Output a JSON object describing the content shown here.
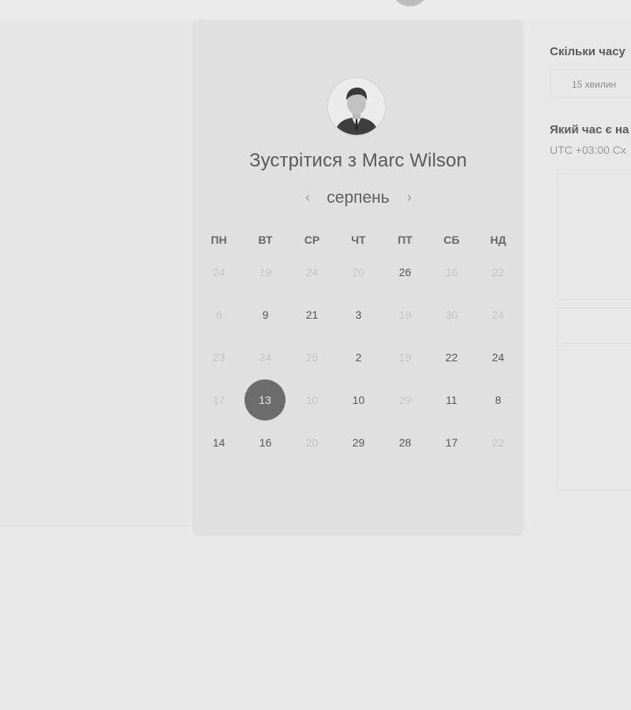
{
  "host": {
    "title": "Зустрітися з Marc Wilson",
    "avatar_icon": "person-avatar"
  },
  "calendar": {
    "month": "серпень",
    "prev_icon": "chevron-left-icon",
    "next_icon": "chevron-right-icon",
    "prev_glyph": "‹",
    "next_glyph": "›",
    "weekdays": [
      "ПН",
      "ВТ",
      "СР",
      "ЧТ",
      "ПТ",
      "СБ",
      "НД"
    ],
    "weeks": [
      [
        {
          "d": "24",
          "m": true
        },
        {
          "d": "19",
          "m": true
        },
        {
          "d": "24",
          "m": true
        },
        {
          "d": "20",
          "m": true
        },
        {
          "d": "26",
          "m": false
        },
        {
          "d": "16",
          "m": true
        },
        {
          "d": "22",
          "m": true
        }
      ],
      [
        {
          "d": "6",
          "m": true
        },
        {
          "d": "9",
          "m": false
        },
        {
          "d": "21",
          "m": false
        },
        {
          "d": "3",
          "m": false
        },
        {
          "d": "19",
          "m": true
        },
        {
          "d": "30",
          "m": true
        },
        {
          "d": "24",
          "m": true
        }
      ],
      [
        {
          "d": "23",
          "m": true
        },
        {
          "d": "24",
          "m": true
        },
        {
          "d": "25",
          "m": true
        },
        {
          "d": "2",
          "m": false
        },
        {
          "d": "19",
          "m": true
        },
        {
          "d": "22",
          "m": false
        },
        {
          "d": "24",
          "m": false
        }
      ],
      [
        {
          "d": "17",
          "m": true
        },
        {
          "d": "13",
          "m": false,
          "selected": true
        },
        {
          "d": "10",
          "m": true
        },
        {
          "d": "10",
          "m": false
        },
        {
          "d": "29",
          "m": true
        },
        {
          "d": "11",
          "m": false
        },
        {
          "d": "8",
          "m": false
        }
      ],
      [
        {
          "d": "14",
          "m": false
        },
        {
          "d": "16",
          "m": false
        },
        {
          "d": "20",
          "m": true
        },
        {
          "d": "29",
          "m": false
        },
        {
          "d": "28",
          "m": false
        },
        {
          "d": "17",
          "m": false
        },
        {
          "d": "22",
          "m": true
        }
      ]
    ]
  },
  "booking": {
    "duration_label": "Скільки часу",
    "duration_value": "15 хвилин",
    "time_label": "Який час є на",
    "timezone": "UTC +03:00 Сх"
  },
  "colors": {
    "selected_day_bg": "#6c6c6c",
    "card_bg": "#e0e0e0",
    "page_bg": "#e8e8e8"
  }
}
